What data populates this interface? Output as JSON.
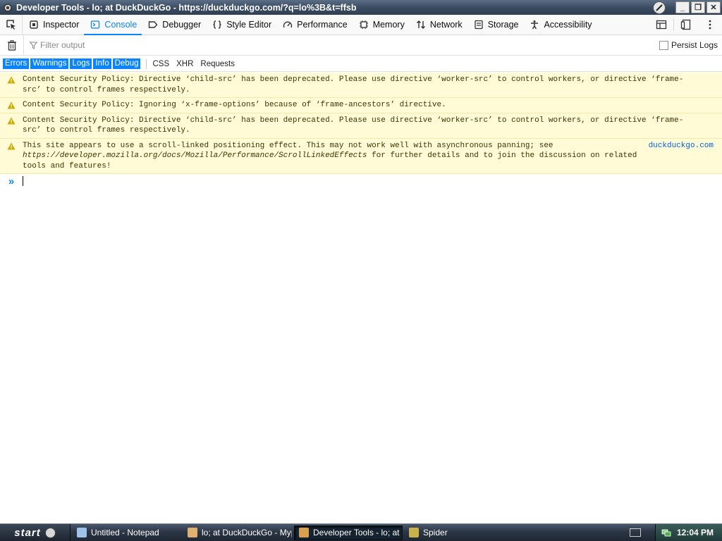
{
  "window": {
    "title": "Developer Tools - lo; at DuckDuckGo - https://duckduckgo.com/?q=lo%3B&t=ffsb"
  },
  "toolbar": {
    "tabs": [
      {
        "label": "Inspector",
        "icon": "inspector-icon"
      },
      {
        "label": "Console",
        "icon": "console-icon",
        "active": true
      },
      {
        "label": "Debugger",
        "icon": "debugger-icon"
      },
      {
        "label": "Style Editor",
        "icon": "style-editor-icon"
      },
      {
        "label": "Performance",
        "icon": "performance-icon"
      },
      {
        "label": "Memory",
        "icon": "memory-icon"
      },
      {
        "label": "Network",
        "icon": "network-icon"
      },
      {
        "label": "Storage",
        "icon": "storage-icon"
      },
      {
        "label": "Accessibility",
        "icon": "accessibility-icon"
      }
    ]
  },
  "filter": {
    "placeholder": "Filter output",
    "persist_logs": "Persist Logs"
  },
  "levels": {
    "active": [
      "Errors",
      "Warnings",
      "Logs",
      "Info",
      "Debug"
    ],
    "plain": [
      "CSS",
      "XHR",
      "Requests"
    ]
  },
  "messages": [
    {
      "text": "Content Security Policy: Directive ‘child-src’ has been deprecated. Please use directive ‘worker-src’ to control workers, or directive ‘frame-src’ to control frames respectively."
    },
    {
      "text": "Content Security Policy: Ignoring ‘x-frame-options’ because of ‘frame-ancestors’ directive."
    },
    {
      "text": "Content Security Policy: Directive ‘child-src’ has been deprecated. Please use directive ‘worker-src’ to control workers, or directive ‘frame-src’ to control frames respectively."
    },
    {
      "text_a": "This site appears to use a scroll-linked positioning effect. This may not work well with asynchronous panning; see ",
      "link": "https://developer.mozilla.org/docs/Mozilla/Performance/ScrollLinkedEffects",
      "text_b": " for further details and to join the discussion on related tools and features!",
      "source": "duckduckgo.com"
    }
  ],
  "taskbar": {
    "start": "start",
    "tasks": [
      {
        "label": "Untitled - Notepad"
      },
      {
        "label": "lo; at DuckDuckGo - Mypal"
      },
      {
        "label": "Developer Tools - lo; at ...",
        "active": true
      },
      {
        "label": "Spider"
      }
    ],
    "clock": "12:04 PM"
  },
  "colors": {
    "accent": "#0a84ff",
    "warning_bg": "#fffbd6",
    "warning_icon": "#c8a900"
  }
}
